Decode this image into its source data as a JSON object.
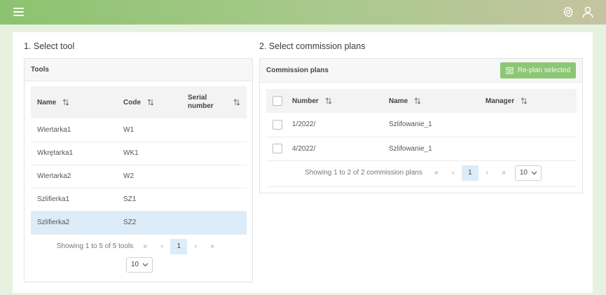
{
  "header": {
    "menu_icon": "hamburger-icon",
    "settings_icon": "gear-icon",
    "user_icon": "user-icon"
  },
  "tools": {
    "section_title": "1. Select tool",
    "panel_title": "Tools",
    "columns": {
      "name": "Name",
      "code": "Code",
      "serial": "Serial number"
    },
    "rows": [
      {
        "name": "Wiertarka1",
        "code": "W1",
        "serial": ""
      },
      {
        "name": "Wkrętarka1",
        "code": "WK1",
        "serial": ""
      },
      {
        "name": "Wiertarka2",
        "code": "W2",
        "serial": ""
      },
      {
        "name": "Szlifierka1",
        "code": "SZ1",
        "serial": ""
      },
      {
        "name": "Szlifierka2",
        "code": "SZ2",
        "serial": "",
        "selected": true
      }
    ],
    "pager": {
      "summary": "Showing 1 to 5 of 5 tools",
      "first": "«",
      "prev": "‹",
      "page": "1",
      "next": "›",
      "last": "»",
      "page_size": "10"
    }
  },
  "plans": {
    "section_title": "2. Select commission plans",
    "panel_title": "Commission plans",
    "replan_label": "Re-plan selected",
    "columns": {
      "number": "Number",
      "name": "Name",
      "manager": "Manager"
    },
    "rows": [
      {
        "number": "1/2022/",
        "name": "Szlifowanie_1",
        "manager": ""
      },
      {
        "number": "4/2022/",
        "name": "Szlifowanie_1",
        "manager": ""
      }
    ],
    "pager": {
      "summary": "Showing 1 to 2 of 2 commission plans",
      "first": "«",
      "prev": "‹",
      "page": "1",
      "next": "›",
      "last": "»",
      "page_size": "10"
    }
  },
  "colors": {
    "accent": "#8cc36f",
    "button": "#8cc775",
    "selected_row": "#dcecf8"
  }
}
